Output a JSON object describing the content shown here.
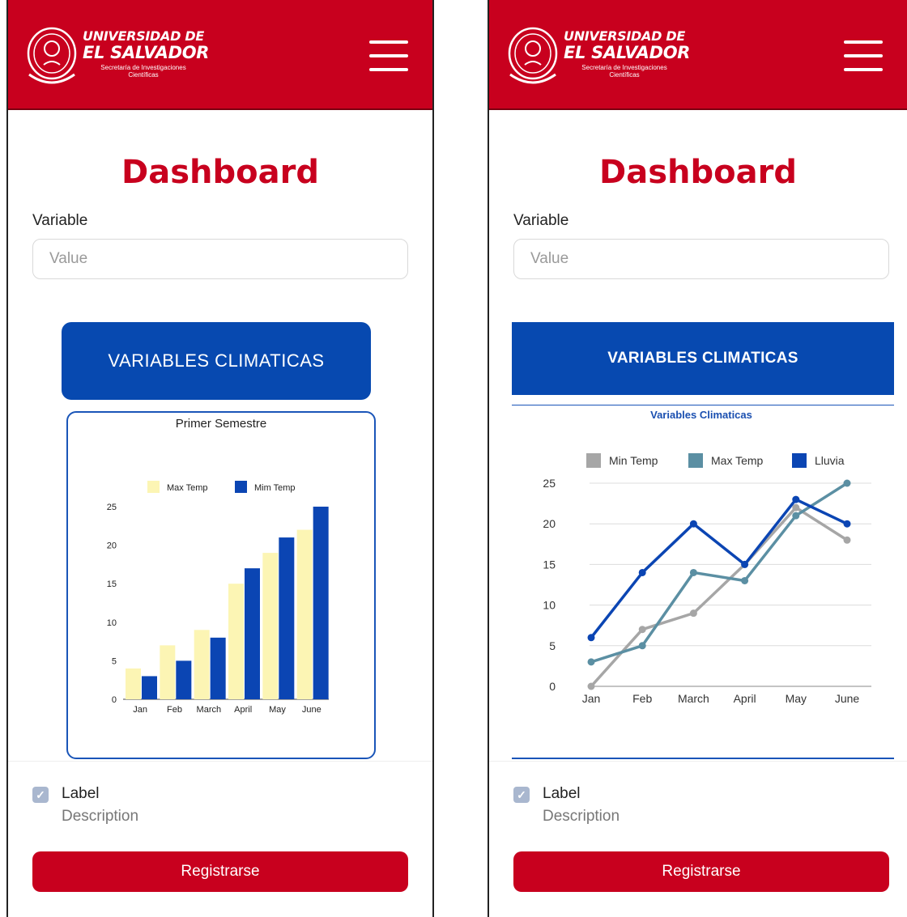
{
  "header": {
    "brand_line1": "UNIVERSIDAD DE",
    "brand_line2": "EL SALVADOR",
    "brand_sub1": "Secretaría de Investigaciones",
    "brand_sub2": "Científicas",
    "menu_icon": "hamburger-menu-icon",
    "background": "#c8001e"
  },
  "page": {
    "title": "Dashboard",
    "title_color": "#c8001e"
  },
  "form": {
    "variable_label": "Variable",
    "variable_placeholder": "Value",
    "checkbox_checked": true,
    "checkbox_label": "Label",
    "checkbox_description": "Description",
    "submit_label": "Registrarse"
  },
  "screens": [
    {
      "section_button": "VARIABLES CLIMATICAS"
    },
    {
      "section_button": "VARIABLES CLIMATICAS"
    }
  ],
  "chart_data": [
    {
      "type": "bar",
      "title": "Primer Semestre",
      "categories": [
        "Jan",
        "Feb",
        "March",
        "April",
        "May",
        "June"
      ],
      "series": [
        {
          "name": "Max Temp",
          "values": [
            4,
            7,
            9,
            15,
            19,
            22
          ],
          "color": "#fcf5b4"
        },
        {
          "name": "Mim Temp",
          "values": [
            3,
            5,
            8,
            17,
            21,
            25
          ],
          "color": "#0b45b3"
        }
      ],
      "ylim": [
        0,
        25
      ],
      "yticks": [
        0,
        5,
        10,
        15,
        20,
        25
      ],
      "legend": "top"
    },
    {
      "type": "line",
      "title": "Variables Climaticas",
      "categories": [
        "Jan",
        "Feb",
        "March",
        "April",
        "May",
        "June"
      ],
      "series": [
        {
          "name": "Min Temp",
          "values": [
            0,
            7,
            9,
            15,
            22,
            18
          ],
          "color": "#a6a6a6"
        },
        {
          "name": "Max Temp",
          "values": [
            3,
            5,
            14,
            13,
            21,
            25
          ],
          "color": "#5b8fa3"
        },
        {
          "name": "Lluvia",
          "values": [
            6,
            14,
            20,
            15,
            23,
            20
          ],
          "color": "#0b45b3"
        }
      ],
      "ylim": [
        0,
        25
      ],
      "yticks": [
        0,
        5,
        10,
        15,
        20,
        25
      ],
      "grid": true,
      "legend": "top"
    }
  ]
}
